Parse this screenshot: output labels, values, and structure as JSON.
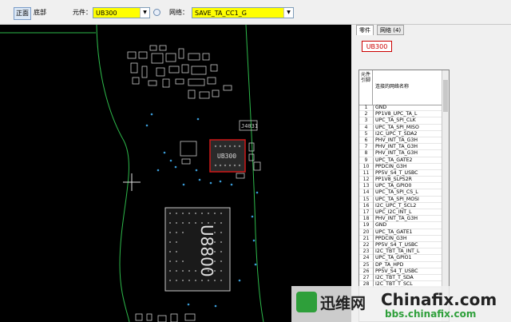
{
  "toolbar": {
    "front_label": "正面",
    "bottom_label": "底部",
    "part_label": "元件：",
    "part_value": "UB300",
    "net_label": "网络：",
    "net_value": "SAVE_TA_CC1_G"
  },
  "board": {
    "connector_label": "J4031",
    "selected_chip_label": "UB300",
    "large_chip_label": "U8800"
  },
  "panel": {
    "tabs": [
      "零件",
      "网络 (4)"
    ],
    "selected_part": "UB300",
    "grid": {
      "pin_header": "元件引脚",
      "net_header": "连接的网络名称",
      "rows": [
        {
          "pin": "1",
          "net": "GND"
        },
        {
          "pin": "2",
          "net": "PP1V8_UPC_TA_L"
        },
        {
          "pin": "3",
          "net": "UPC_TA_SPI_CLK"
        },
        {
          "pin": "4",
          "net": "UPC_TA_SPI_MISO"
        },
        {
          "pin": "5",
          "net": "I2C_UPC_T_SDA2"
        },
        {
          "pin": "6",
          "net": "PHV_INT_TA_G3H"
        },
        {
          "pin": "7",
          "net": "PHV_INT_TA_G3H"
        },
        {
          "pin": "8",
          "net": "PHV_INT_TA_G3H"
        },
        {
          "pin": "9",
          "net": "UPC_TA_GATE2"
        },
        {
          "pin": "10",
          "net": "PPDCIN_G3H"
        },
        {
          "pin": "11",
          "net": "PP5V_S4_T_USBC"
        },
        {
          "pin": "12",
          "net": "PP1V8_SLPS2R"
        },
        {
          "pin": "13",
          "net": "UPC_TA_GPIO0"
        },
        {
          "pin": "14",
          "net": "UPC_TA_SPI_CS_L"
        },
        {
          "pin": "15",
          "net": "UPC_TA_SPI_MOSI"
        },
        {
          "pin": "16",
          "net": "I2C_UPC_T_SCL2"
        },
        {
          "pin": "17",
          "net": "UPC_I2C_INT_L"
        },
        {
          "pin": "18",
          "net": "PHV_INT_TA_G3H"
        },
        {
          "pin": "19",
          "net": "GND"
        },
        {
          "pin": "20",
          "net": "UPC_TA_GATE1"
        },
        {
          "pin": "21",
          "net": "PPDCIN_G3H"
        },
        {
          "pin": "22",
          "net": "PP5V_S4_T_USBC"
        },
        {
          "pin": "23",
          "net": "I2C_TBT_TA_INT_L"
        },
        {
          "pin": "24",
          "net": "UPC_TA_GPIO1"
        },
        {
          "pin": "25",
          "net": "DP_TA_HPD"
        },
        {
          "pin": "26",
          "net": "PP5V_S4_T_USBC"
        },
        {
          "pin": "27",
          "net": "I2C_TBT_T_SDA"
        },
        {
          "pin": "28",
          "net": "I2C_TBT_T_SCL"
        }
      ]
    }
  },
  "watermark": {
    "brand": "迅维网",
    "site": "Chinafix.com",
    "url": "bbs.chinafix.com"
  },
  "colors": {
    "board_bg": "#000000",
    "outline": "#2db84a",
    "highlight": "#d01818",
    "selector_bg": "#ffff00"
  }
}
